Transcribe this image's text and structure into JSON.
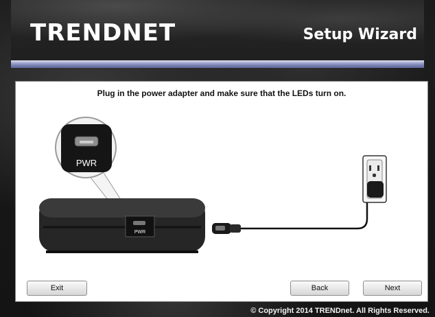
{
  "header": {
    "logo_text": "TRENDNET",
    "title": "Setup Wizard"
  },
  "main": {
    "instruction": "Plug in the power adapter and make sure that the LEDs turn on.",
    "callout_port_label": "PWR",
    "device_port_label": "PWR"
  },
  "buttons": {
    "exit": "Exit",
    "back": "Back",
    "next": "Next"
  },
  "footer": {
    "copyright": "© Copyright 2014 TRENDnet. All Rights Reserved."
  },
  "colors": {
    "accent_bar": "#7f87b8",
    "background": "#1c1c1c"
  }
}
